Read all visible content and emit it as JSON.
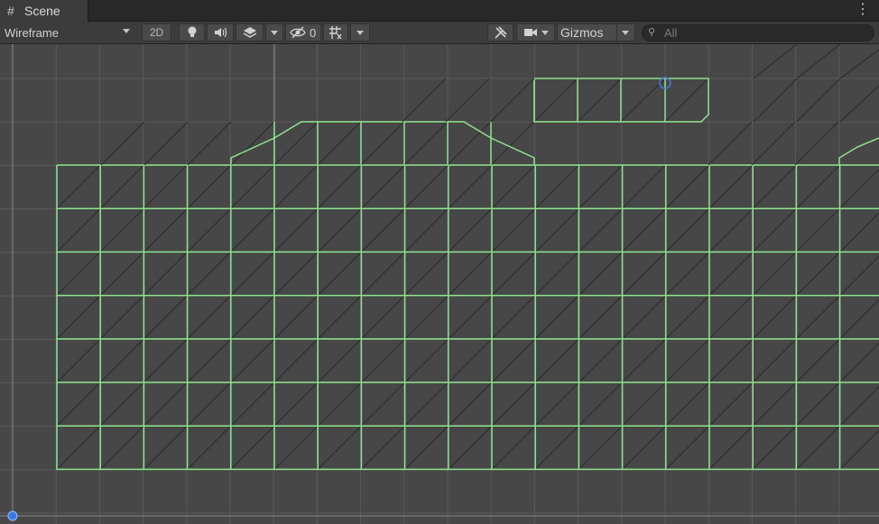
{
  "tab": {
    "label": "Scene"
  },
  "toolbar": {
    "draw_mode": "Wireframe",
    "mode_2d": "2D",
    "hidden_count": "0",
    "gizmos_label": "Gizmos",
    "search_placeholder": "All"
  },
  "icons": {
    "tab": "grid-icon",
    "menu": "kebab-menu-icon",
    "lighting": "lightbulb-icon",
    "audio": "speaker-icon",
    "effects": "layers-icon",
    "visibility": "eye-slash-icon",
    "grid_snap": "grid-snap-icon",
    "tools": "wrench-icon",
    "camera": "camera-icon",
    "search": "search-icon"
  },
  "colors": {
    "background": "#474747",
    "wire": "#8fe48f",
    "grid": "#5a5a5a",
    "toolbar": "#3c3c3c"
  }
}
